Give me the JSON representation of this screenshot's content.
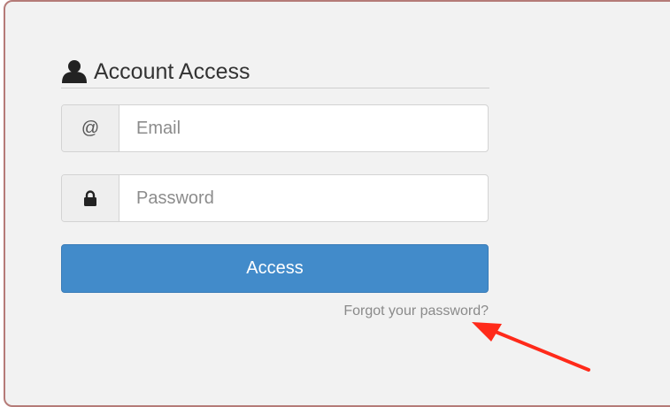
{
  "login": {
    "heading": "Account Access",
    "email": {
      "addon": "@",
      "placeholder": "Email",
      "value": ""
    },
    "password": {
      "placeholder": "Password",
      "value": ""
    },
    "submit_label": "Access",
    "forgot_label": "Forgot your password?"
  },
  "icons": {
    "heading_icon": "user-icon",
    "password_icon": "lock-icon",
    "annotation": "red-arrow"
  },
  "colors": {
    "panel_bg": "#f2f2f2",
    "panel_border": "#b57b78",
    "button_bg": "#428bca",
    "link": "#8a8a8a",
    "annotation": "#ff2a1a"
  }
}
